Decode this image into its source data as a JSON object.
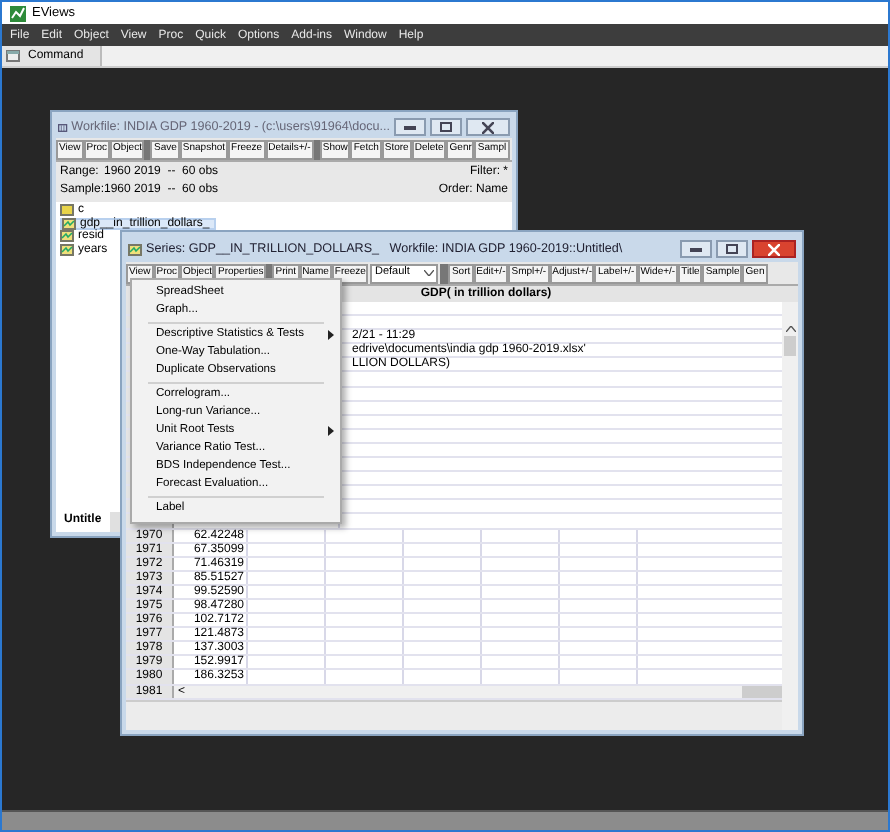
{
  "app": {
    "title": "EViews",
    "menu": [
      "File",
      "Edit",
      "Object",
      "View",
      "Proc",
      "Quick",
      "Options",
      "Add-ins",
      "Window",
      "Help"
    ],
    "command_tab": "Command"
  },
  "workfile": {
    "title": "Workfile: INDIA GDP 1960-2019 - (c:\\users\\91964\\docu...",
    "toolbar_groups": [
      [
        "View",
        "Proc",
        "Object"
      ],
      [
        "Save",
        "Snapshot",
        "Freeze",
        "Details+/-"
      ],
      [
        "Show",
        "Fetch",
        "Store",
        "Delete",
        "Genr",
        "Sampl"
      ]
    ],
    "range_label": "Range:",
    "range": "1960 2019  --  60 obs",
    "filter": "Filter: *",
    "sample_label": "Sample:",
    "sample": "1960 2019  --  60 obs",
    "order": "Order: Name",
    "objects": [
      {
        "name": "c",
        "kind": "coef",
        "selected": false
      },
      {
        "name": "gdp__in_trillion_dollars_",
        "kind": "series",
        "selected": true
      },
      {
        "name": "resid",
        "kind": "series",
        "selected": false
      },
      {
        "name": "years",
        "kind": "series",
        "selected": false
      }
    ],
    "tab": "Untitle"
  },
  "series": {
    "title": "Series: GDP__IN_TRILLION_DOLLARS_   Workfile: INDIA GDP 1960-2019::Untitled\\",
    "toolbar_groups": [
      [
        "View",
        "Proc",
        "Object",
        "Properties"
      ],
      [
        "Print",
        "Name",
        "Freeze"
      ]
    ],
    "dropdown": "Default",
    "toolbar_right": [
      "Sort",
      "Edit+/-",
      "Smpl+/-",
      "Adjust+/-",
      "Label+/-",
      "Wide+/-",
      "Title",
      "Sample",
      "Gen"
    ],
    "header": "GDP( in trillion dollars)",
    "notes": [
      "2/21 - 11:29",
      "edrive\\documents\\india gdp 1960-2019.xlsx'",
      "LLION DOLLARS)"
    ],
    "rows": [
      {
        "obs": "1970",
        "value": "62.42248"
      },
      {
        "obs": "1971",
        "value": "67.35099"
      },
      {
        "obs": "1972",
        "value": "71.46319"
      },
      {
        "obs": "1973",
        "value": "85.51527"
      },
      {
        "obs": "1974",
        "value": "99.52590"
      },
      {
        "obs": "1975",
        "value": "98.47280"
      },
      {
        "obs": "1976",
        "value": "102.7172"
      },
      {
        "obs": "1977",
        "value": "121.4873"
      },
      {
        "obs": "1978",
        "value": "137.3003"
      },
      {
        "obs": "1979",
        "value": "152.9917"
      },
      {
        "obs": "1980",
        "value": "186.3253"
      },
      {
        "obs": "1981",
        "value": ""
      }
    ],
    "hscroll_left": "<"
  },
  "menu": [
    {
      "kind": "item",
      "label": "SpreadSheet",
      "submenu": false
    },
    {
      "kind": "item",
      "label": "Graph...",
      "submenu": false
    },
    {
      "kind": "separator"
    },
    {
      "kind": "item",
      "label": "Descriptive Statistics & Tests",
      "submenu": true
    },
    {
      "kind": "item",
      "label": "One-Way Tabulation...",
      "submenu": false
    },
    {
      "kind": "item",
      "label": "Duplicate Observations",
      "submenu": false
    },
    {
      "kind": "separator"
    },
    {
      "kind": "item",
      "label": "Correlogram...",
      "submenu": false
    },
    {
      "kind": "item",
      "label": "Long-run Variance...",
      "submenu": false
    },
    {
      "kind": "item",
      "label": "Unit Root Tests",
      "submenu": true
    },
    {
      "kind": "item",
      "label": "Variance Ratio Test...",
      "submenu": false
    },
    {
      "kind": "item",
      "label": "BDS Independence Test...",
      "submenu": false
    },
    {
      "kind": "item",
      "label": "Forecast Evaluation...",
      "submenu": false
    },
    {
      "kind": "separator"
    },
    {
      "kind": "item",
      "label": "Label",
      "submenu": false
    }
  ]
}
